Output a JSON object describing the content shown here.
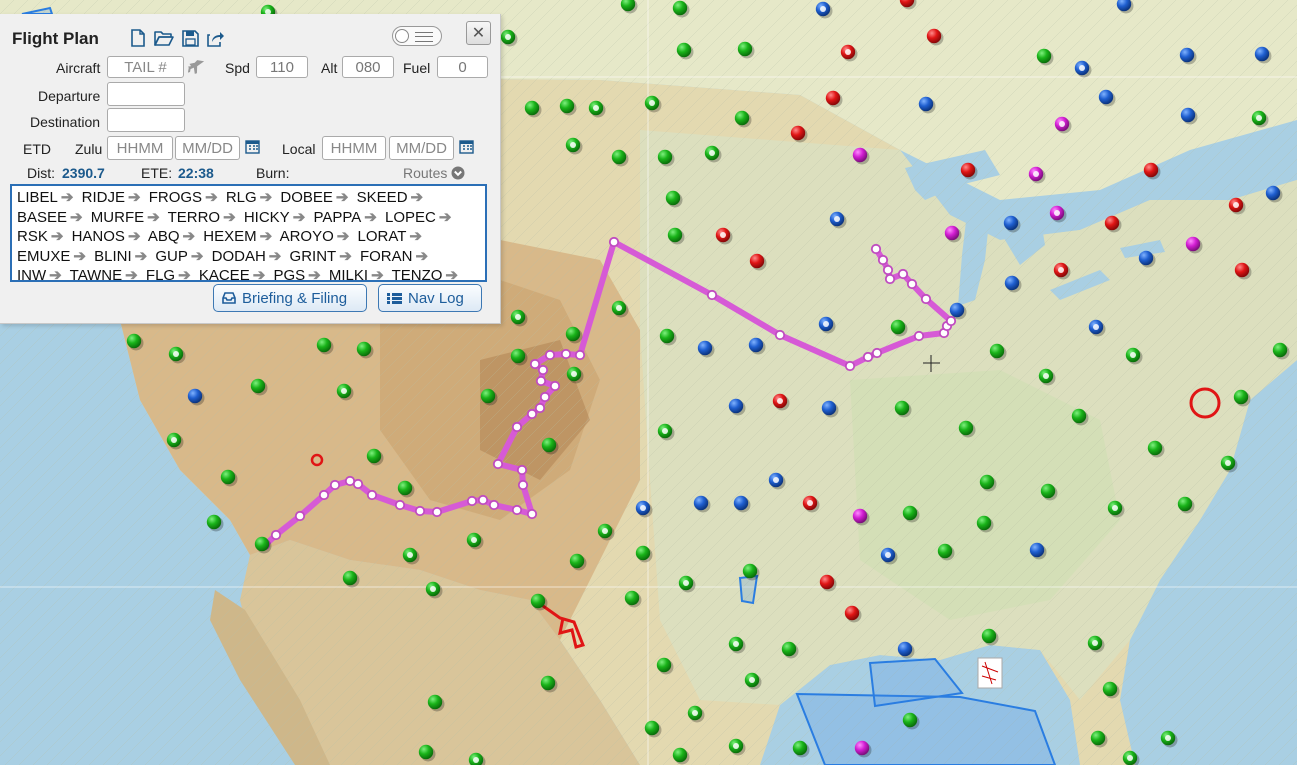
{
  "flight_plan": {
    "title": "Flight Plan",
    "toolbar_icons": [
      "new-file-icon",
      "open-folder-icon",
      "save-icon",
      "share-icon"
    ],
    "aircraft_label": "Aircraft",
    "aircraft_placeholder": "TAIL #",
    "spd_label": "Spd",
    "spd_value": "110",
    "alt_label": "Alt",
    "alt_value": "080",
    "fuel_label": "Fuel",
    "fuel_value": "0",
    "departure_label": "Departure",
    "destination_label": "Destination",
    "etd_label": "ETD",
    "zulu_label": "Zulu",
    "local_label": "Local",
    "time_placeholder": "HHMM",
    "date_placeholder": "MM/DD",
    "dist_label": "Dist:",
    "dist_value": "2390.7",
    "ete_label": "ETE:",
    "ete_value": "22:38",
    "burn_label": "Burn:",
    "routes_label": "Routes",
    "route_waypoints": [
      "LIBEL",
      "RIDJE",
      "FROGS",
      "RLG",
      "DOBEE",
      "SKEED",
      "BASEE",
      "MURFE",
      "TERRO",
      "HICKY",
      "PAPPA",
      "LOPEC",
      "RSK",
      "HANOS",
      "ABQ",
      "HEXEM",
      "AROYO",
      "LORAT",
      "EMUXE",
      "BLINI",
      "GUP",
      "DODAH",
      "GRINT",
      "FORAN",
      "INW",
      "TAWNE",
      "FLG",
      "KACEE",
      "PGS",
      "MILKI",
      "TENZO"
    ],
    "briefing_label": "Briefing & Filing",
    "navlog_label": "Nav Log"
  },
  "map": {
    "route_color": "#d65ad6",
    "vfr_color": "#1faa1f",
    "mvfr_color": "#1f5fd0",
    "ifr_color": "#e01515",
    "lifr_color": "#d21dd2"
  }
}
